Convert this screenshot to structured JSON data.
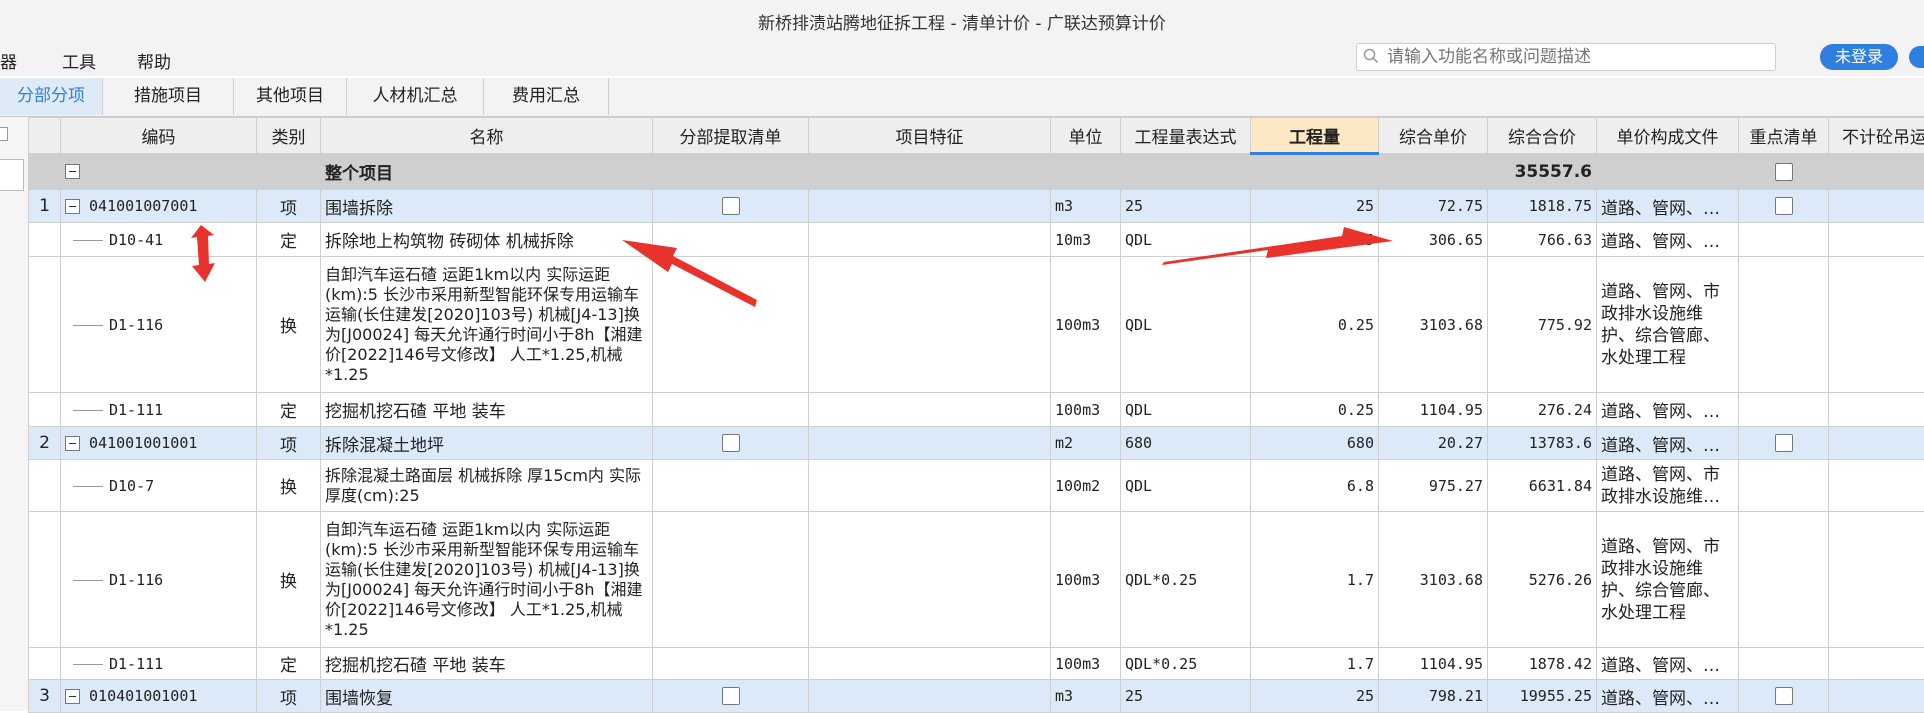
{
  "window": {
    "title": "新桥排渍站腾地征拆工程 - 清单计价 - 广联达预算计价"
  },
  "menu": {
    "partial": "器",
    "tools": "工具",
    "help": "帮助"
  },
  "search": {
    "placeholder": "请输入功能名称或问题描述"
  },
  "login": {
    "label": "未登录"
  },
  "tabs": [
    "分部分项",
    "措施项目",
    "其他项目",
    "人材机汇总",
    "费用汇总"
  ],
  "columns": [
    "编码",
    "类别",
    "名称",
    "分部提取清单",
    "项目特征",
    "单位",
    "工程量表达式",
    "工程量",
    "综合单价",
    "综合合价",
    "单价构成文件",
    "重点清单",
    "不计砼吊运"
  ],
  "whole": {
    "name": "整个项目",
    "total": "35557.6"
  },
  "items": [
    {
      "seq": "1",
      "code": "041001007001",
      "type": "项",
      "name": "围墙拆除",
      "unit": "m3",
      "expr": "25",
      "qty": "25",
      "price": "72.75",
      "total": "1818.75",
      "file": "道路、管网、…"
    },
    {
      "code": "D10-41",
      "type": "定",
      "name": "拆除地上构筑物 砖砌体 机械拆除",
      "unit": "10m3",
      "expr": "QDL",
      "qty": "2.5",
      "price": "306.65",
      "total": "766.63",
      "file": "道路、管网、…"
    },
    {
      "code": "D1-116",
      "type": "换",
      "name": "自卸汽车运石碴 运距1km以内  实际运距(km):5  长沙市采用新型智能环保专用运输车运输(长住建发[2020]103号) 机械[J4-13]换为[J00024]  每天允许通行时间小于8h【湘建价[2022]146号文修改】 人工*1.25,机械*1.25",
      "unit": "100m3",
      "expr": "QDL",
      "qty": "0.25",
      "price": "3103.68",
      "total": "775.92",
      "file": "道路、管网、市政排水设施维护、综合管廊、水处理工程"
    },
    {
      "code": "D1-111",
      "type": "定",
      "name": "挖掘机挖石碴 平地 装车",
      "unit": "100m3",
      "expr": "QDL",
      "qty": "0.25",
      "price": "1104.95",
      "total": "276.24",
      "file": "道路、管网、…"
    },
    {
      "seq": "2",
      "code": "041001001001",
      "type": "项",
      "name": "拆除混凝土地坪",
      "unit": "m2",
      "expr": "680",
      "qty": "680",
      "price": "20.27",
      "total": "13783.6",
      "file": "道路、管网、…"
    },
    {
      "code": "D10-7",
      "type": "换",
      "name": "拆除混凝土路面层 机械拆除 厚15cm内 实际厚度(cm):25",
      "unit": "100m2",
      "expr": "QDL",
      "qty": "6.8",
      "price": "975.27",
      "total": "6631.84",
      "file": "道路、管网、市政排水设施维…"
    },
    {
      "code": "D1-116",
      "type": "换",
      "name": "自卸汽车运石碴 运距1km以内  实际运距(km):5  长沙市采用新型智能环保专用运输车运输(长住建发[2020]103号) 机械[J4-13]换为[J00024]  每天允许通行时间小于8h【湘建价[2022]146号文修改】 人工*1.25,机械*1.25",
      "unit": "100m3",
      "expr": "QDL*0.25",
      "qty": "1.7",
      "price": "3103.68",
      "total": "5276.26",
      "file": "道路、管网、市政排水设施维护、综合管廊、水处理工程"
    },
    {
      "code": "D1-111",
      "type": "定",
      "name": "挖掘机挖石碴 平地 装车",
      "unit": "100m3",
      "expr": "QDL*0.25",
      "qty": "1.7",
      "price": "1104.95",
      "total": "1878.42",
      "file": "道路、管网、…"
    },
    {
      "seq": "3",
      "code": "010401001001",
      "type": "项",
      "name": "围墙恢复",
      "unit": "m3",
      "expr": "25",
      "qty": "25",
      "price": "798.21",
      "total": "19955.25",
      "file": "道路、管网、…"
    }
  ],
  "annotation_color": "#e8322b"
}
